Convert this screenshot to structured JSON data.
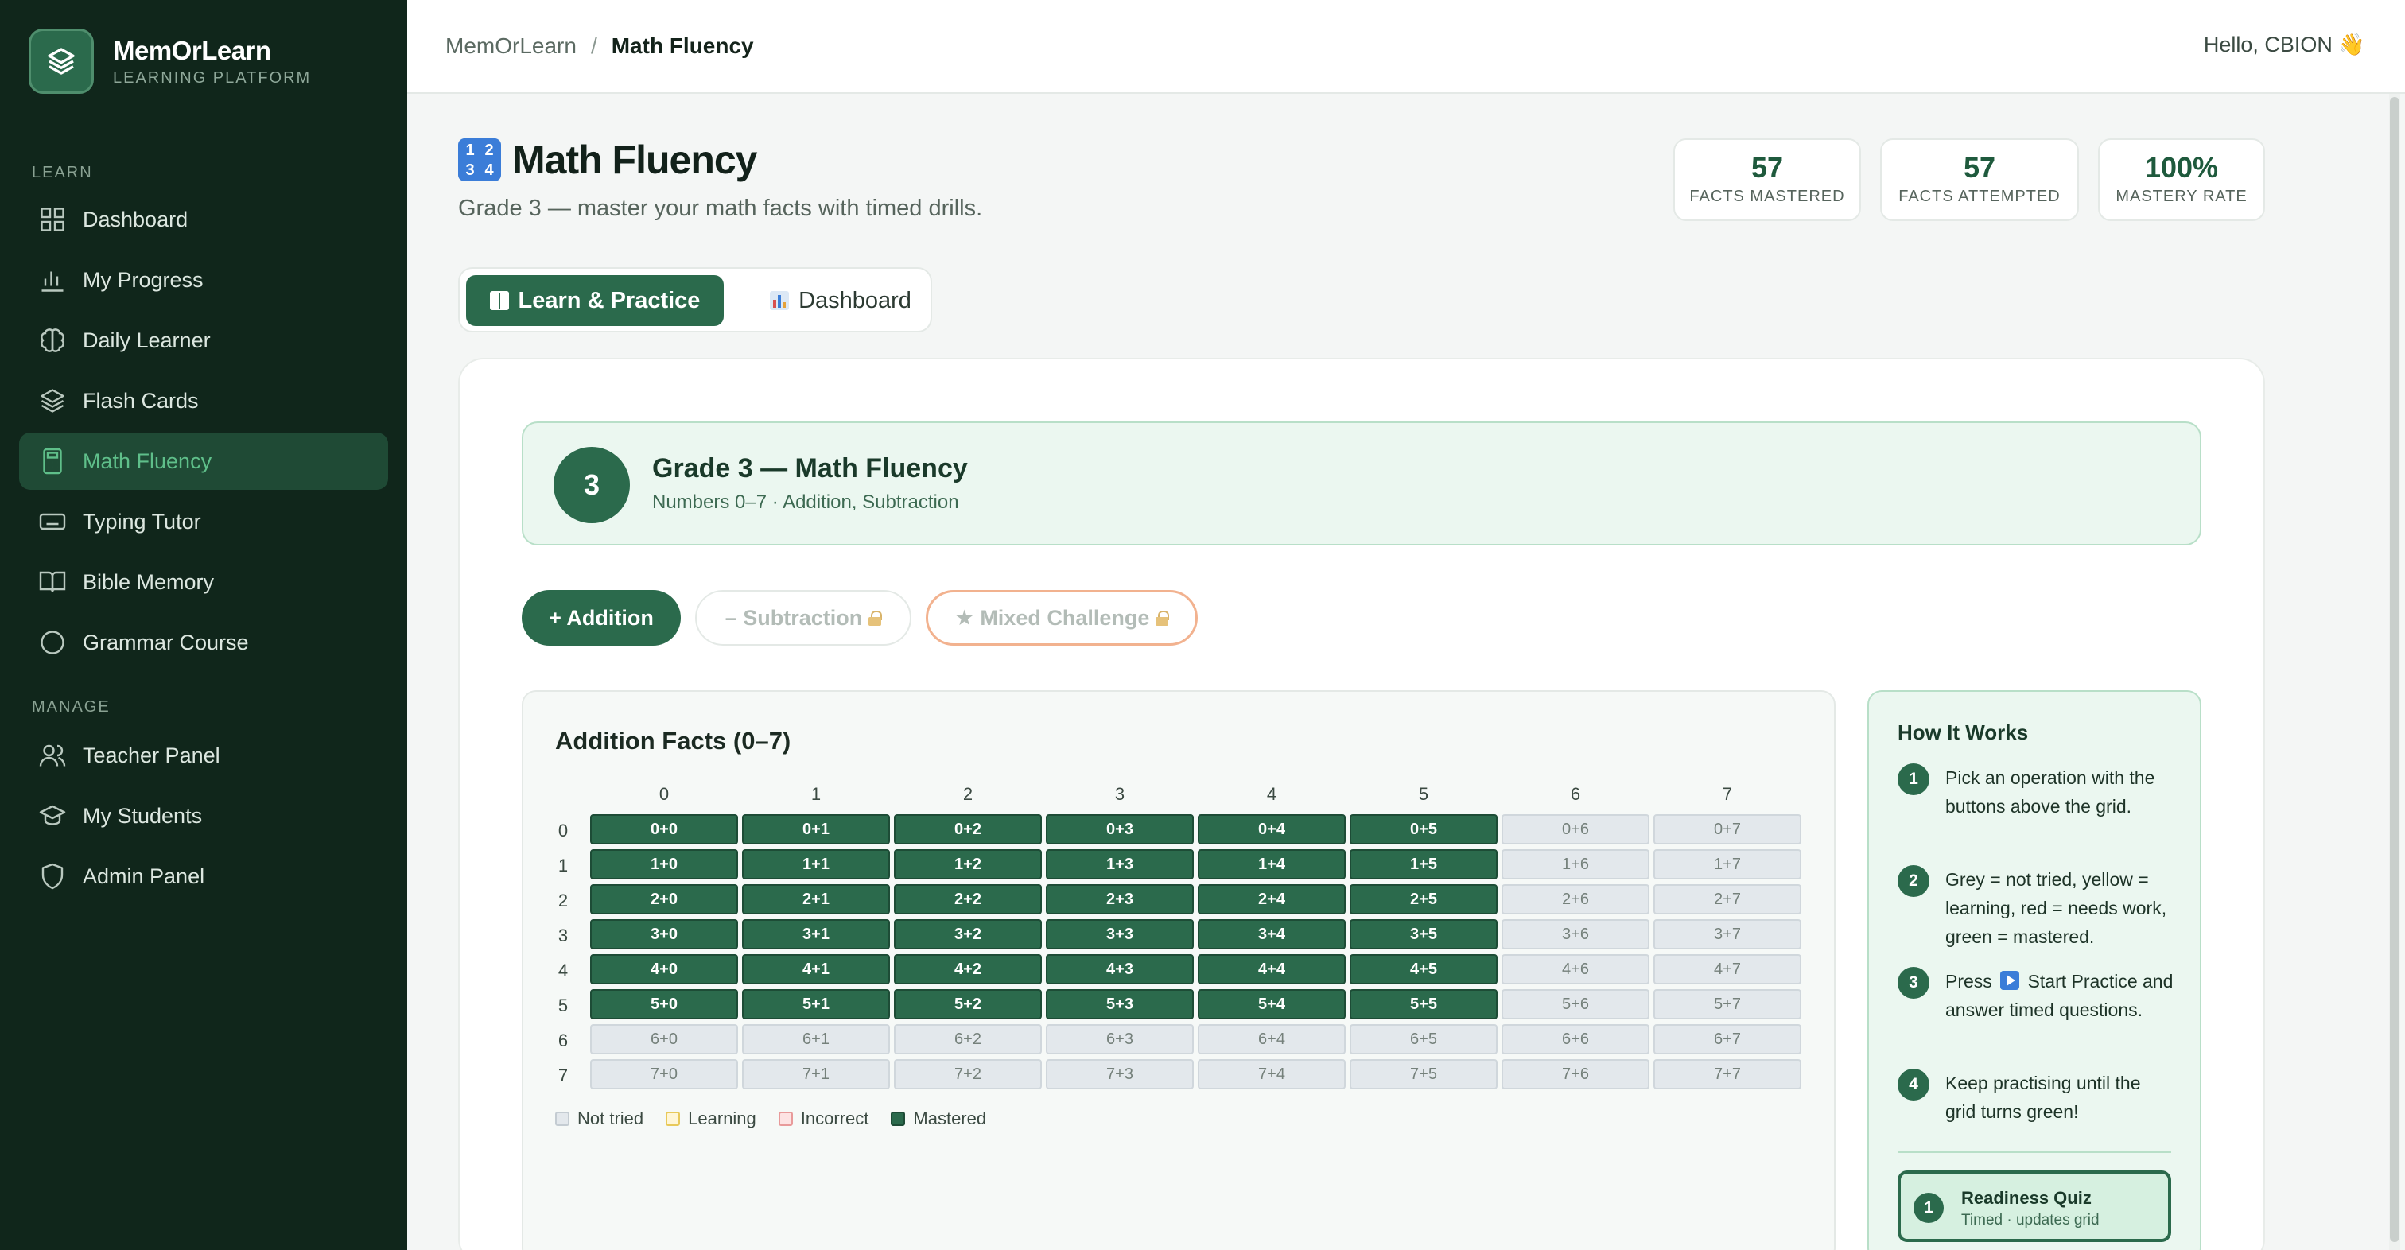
{
  "brand": {
    "name": "MemOrLearn",
    "subtitle": "LEARNING PLATFORM"
  },
  "sidebar": {
    "sections": [
      {
        "label": "LEARN"
      },
      {
        "label": "MANAGE"
      }
    ],
    "items": [
      {
        "label": "Dashboard",
        "icon": "grid-icon"
      },
      {
        "label": "My Progress",
        "icon": "bar-chart-icon"
      },
      {
        "label": "Daily Learner",
        "icon": "brain-icon"
      },
      {
        "label": "Flash Cards",
        "icon": "layers-icon"
      },
      {
        "label": "Math Fluency",
        "icon": "calculator-icon",
        "active": true
      },
      {
        "label": "Typing Tutor",
        "icon": "keyboard-icon"
      },
      {
        "label": "Bible Memory",
        "icon": "book-icon"
      },
      {
        "label": "Grammar Course",
        "icon": "circle-icon"
      },
      {
        "label": "Teacher Panel",
        "icon": "users-icon"
      },
      {
        "label": "My Students",
        "icon": "graduation-cap-icon"
      },
      {
        "label": "Admin Panel",
        "icon": "shield-icon"
      }
    ]
  },
  "topbar": {
    "breadcrumb_root": "MemOrLearn",
    "breadcrumb_sep": "/",
    "breadcrumb_current": "Math Fluency",
    "greeting": "Hello, CBION 👋"
  },
  "page": {
    "title": "Math Fluency",
    "subtitle": "Grade 3 — master your math facts with timed drills."
  },
  "stats": [
    {
      "value": "57",
      "label": "FACTS MASTERED"
    },
    {
      "value": "57",
      "label": "FACTS ATTEMPTED"
    },
    {
      "value": "100%",
      "label": "MASTERY RATE"
    }
  ],
  "tabs": [
    {
      "label": "Learn & Practice",
      "active": true
    },
    {
      "label": "Dashboard",
      "active": false
    }
  ],
  "grade": {
    "number": "3",
    "title": "Grade 3 — Math Fluency",
    "subtitle": "Numbers 0–7 · Addition, Subtraction"
  },
  "operations": {
    "add": "+ Addition",
    "sub": "– Subtraction",
    "mix": "★ Mixed Challenge"
  },
  "grid": {
    "title": "Addition Facts (0–7)",
    "columns": [
      "0",
      "1",
      "2",
      "3",
      "4",
      "5",
      "6",
      "7"
    ],
    "rows": [
      "0",
      "1",
      "2",
      "3",
      "4",
      "5",
      "6",
      "7"
    ],
    "mastered_max_a": 5,
    "mastered_max_b": 5,
    "legend": [
      {
        "label": "Not tried",
        "color": "#e3e8ec",
        "border": "#c4ccd2"
      },
      {
        "label": "Learning",
        "color": "#fff6d6",
        "border": "#e8c95a"
      },
      {
        "label": "Incorrect",
        "color": "#fde3e3",
        "border": "#e89a9a"
      },
      {
        "label": "Mastered",
        "color": "#2b6a4c",
        "border": "#1d4c36"
      }
    ]
  },
  "how": {
    "title": "How It Works",
    "steps": [
      {
        "num": "1",
        "text": "Pick an operation with the buttons above the grid."
      },
      {
        "num": "2",
        "text": "Grey = not tried, yellow = learning, red = needs work, green = mastered."
      },
      {
        "num": "3",
        "text_before": "Press",
        "text_after": "Start Practice and answer timed questions."
      },
      {
        "num": "4",
        "text": "Keep practising until the grid turns green!"
      }
    ],
    "quiz": {
      "num": "1",
      "title": "Readiness Quiz",
      "subtitle": "Timed · updates grid"
    }
  },
  "colors": {
    "accent": "#2b6a4c",
    "sidebar_bg": "#10261b",
    "active_text": "#5fbf8a"
  }
}
